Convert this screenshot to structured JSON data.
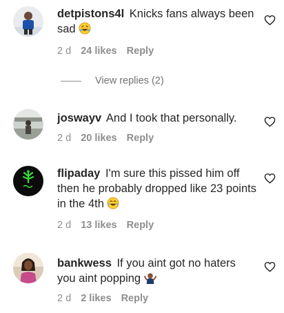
{
  "comments": [
    {
      "username": "detpistons4l",
      "text": "Knicks fans always been sad",
      "time": "2 d",
      "likes": "24 likes",
      "reply": "Reply",
      "emoji": "rofl-emoji",
      "view_replies": "View replies (2)"
    },
    {
      "username": "joswayv",
      "text": "And I took that personally.",
      "time": "2 d",
      "likes": "20 likes",
      "reply": "Reply"
    },
    {
      "username": "flipaday",
      "text": "I'm sure this pissed him off then he probably dropped like 23 points in the 4th",
      "time": "2 d",
      "likes": "13 likes",
      "reply": "Reply",
      "emoji": "joy-emoji"
    },
    {
      "username": "bankwess",
      "text": "If you aint got no haters you aint popping",
      "time": "2 d",
      "likes": "2 likes",
      "reply": "Reply",
      "emoji": "person-gesturing-no-emoji"
    }
  ],
  "icons": {
    "like": "heart-outline-icon"
  },
  "colors": {
    "text": "#262626",
    "meta": "#8e8e8e",
    "background": "#ffffff"
  }
}
